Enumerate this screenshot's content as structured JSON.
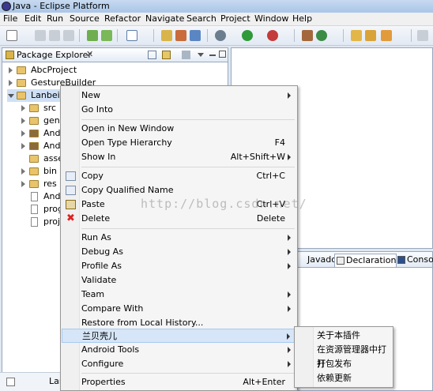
{
  "window": {
    "title": "Java - Eclipse Platform"
  },
  "menubar": [
    "File",
    "Edit",
    "Run",
    "Source",
    "Refactor",
    "Navigate",
    "Search",
    "Project",
    "Window",
    "Help"
  ],
  "explorer": {
    "tab_label": "Package Explorer",
    "close_glyph": "✕",
    "items": [
      {
        "label": "AbcProject"
      },
      {
        "label": "GestureBuilder"
      },
      {
        "label": "LanbeiG"
      },
      {
        "label": "src"
      },
      {
        "label": "gen"
      },
      {
        "label": "Andi"
      },
      {
        "label": "Andi"
      },
      {
        "label": "asse"
      },
      {
        "label": "bin"
      },
      {
        "label": "res"
      },
      {
        "label": "Andi"
      },
      {
        "label": "prog"
      },
      {
        "label": "proj"
      }
    ],
    "status_text": "Lar"
  },
  "bottom_tabs": [
    "Javadoc",
    "Declaration",
    "Consol"
  ],
  "context_menu": {
    "items": [
      {
        "label": "New",
        "shortcut": "",
        "submenu": true
      },
      {
        "label": "Go Into",
        "shortcut": "",
        "submenu": false
      },
      {
        "label": "Open in New Window",
        "shortcut": "",
        "submenu": false
      },
      {
        "label": "Open Type Hierarchy",
        "shortcut": "F4",
        "submenu": false
      },
      {
        "label": "Show In",
        "shortcut": "Alt+Shift+W",
        "submenu": true
      },
      {
        "label": "Copy",
        "shortcut": "Ctrl+C",
        "submenu": false,
        "icon": "copy-icon"
      },
      {
        "label": "Copy Qualified Name",
        "shortcut": "",
        "submenu": false,
        "icon": "copy-qualified-icon"
      },
      {
        "label": "Paste",
        "shortcut": "Ctrl+V",
        "submenu": false,
        "icon": "paste-icon"
      },
      {
        "label": "Delete",
        "shortcut": "Delete",
        "submenu": false,
        "icon": "delete-icon"
      },
      {
        "label": "Run As",
        "shortcut": "",
        "submenu": true
      },
      {
        "label": "Debug As",
        "shortcut": "",
        "submenu": true
      },
      {
        "label": "Profile As",
        "shortcut": "",
        "submenu": true
      },
      {
        "label": "Validate",
        "shortcut": "",
        "submenu": false
      },
      {
        "label": "Team",
        "shortcut": "",
        "submenu": true
      },
      {
        "label": "Compare With",
        "shortcut": "",
        "submenu": true
      },
      {
        "label": "Restore from Local History...",
        "shortcut": "",
        "submenu": false
      },
      {
        "label": "兰贝壳儿",
        "shortcut": "",
        "submenu": true,
        "highlighted": true
      },
      {
        "label": "Android Tools",
        "shortcut": "",
        "submenu": true
      },
      {
        "label": "Configure",
        "shortcut": "",
        "submenu": true
      },
      {
        "label": "Properties",
        "shortcut": "Alt+Enter",
        "submenu": false
      }
    ]
  },
  "submenu": {
    "items": [
      "关于本插件",
      "在资源管理器中打开",
      "打包发布",
      "依赖更新"
    ]
  },
  "watermark": "http://blog.csdn.net/"
}
